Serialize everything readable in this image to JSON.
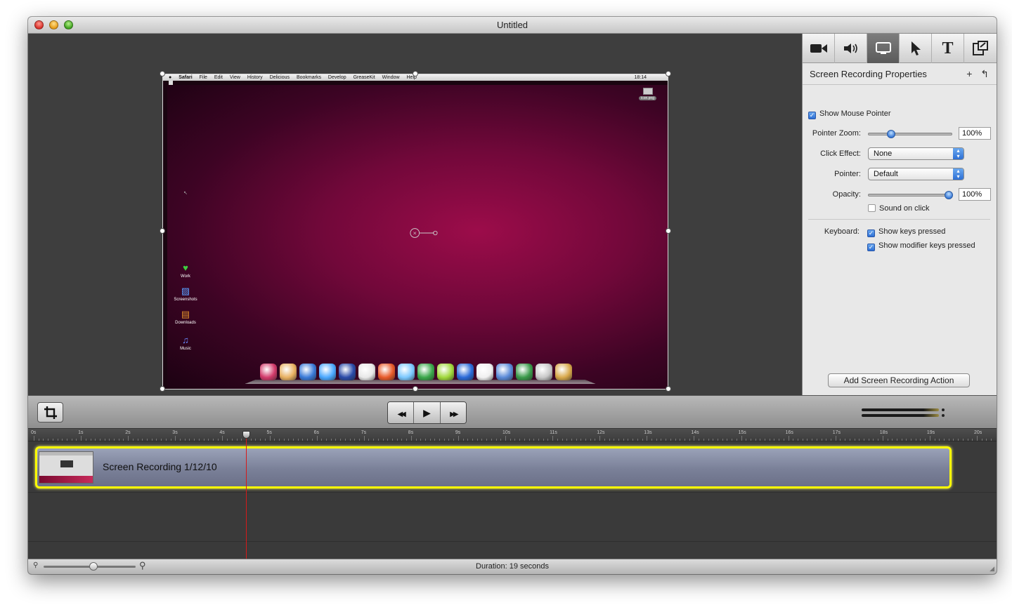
{
  "window": {
    "title": "Untitled"
  },
  "preview": {
    "menubar_items": [
      "Safari",
      "File",
      "Edit",
      "View",
      "History",
      "Delicious",
      "Bookmarks",
      "Develop",
      "GreaseKit",
      "Window",
      "Help"
    ],
    "menubar_time": "18:14",
    "desktop_icons": [
      {
        "label": "Work",
        "icon": "heart-folder-icon",
        "color": "#3fcf3f"
      },
      {
        "label": "Screenshots",
        "icon": "screenshots-folder-icon",
        "color": "#5aa0ff"
      },
      {
        "label": "Downloads",
        "icon": "downloads-folder-icon",
        "color": "#e0902a"
      },
      {
        "label": "Music",
        "icon": "music-folder-icon",
        "color": "#6a8aff"
      }
    ],
    "corner_file_label": "icon.png",
    "dock_colors": [
      "#d23a6a",
      "#e8b060",
      "#3a7ad8",
      "#4aa8ff",
      "#2a4aa8",
      "#e8e8e8",
      "#e85a2a",
      "#7ac8ff",
      "#3aa84a",
      "#a0d83a",
      "#2a6ad8",
      "#f0f0f0",
      "#5a8ad8",
      "#3a9a4a",
      "#c8c8c8",
      "#d8a84a"
    ]
  },
  "inspector": {
    "tabs": [
      {
        "name": "tab-video",
        "icon": "video-camera-icon",
        "glyph": "▰"
      },
      {
        "name": "tab-audio",
        "icon": "speaker-icon",
        "glyph": "◀"
      },
      {
        "name": "tab-screen",
        "icon": "screen-icon",
        "glyph": "▭"
      },
      {
        "name": "tab-pointer",
        "icon": "pointer-icon",
        "glyph": "➤"
      },
      {
        "name": "tab-text",
        "icon": "text-icon",
        "glyph": "T"
      },
      {
        "name": "tab-export",
        "icon": "export-icon",
        "glyph": "⧉"
      }
    ],
    "section_title": "Screen Recording Properties",
    "add_glyph": "+",
    "revert_glyph": "↰",
    "show_mouse_pointer": "Show Mouse Pointer",
    "pointer_zoom_label": "Pointer Zoom:",
    "pointer_zoom_value": "100%",
    "pointer_zoom_level": 0.24,
    "click_effect_label": "Click Effect:",
    "click_effect_value": "None",
    "pointer_label": "Pointer:",
    "pointer_value": "Default",
    "opacity_label": "Opacity:",
    "opacity_value": "100%",
    "opacity_level": 1.0,
    "sound_on_click": "Sound on click",
    "keyboard_label": "Keyboard:",
    "show_keys_pressed": "Show keys pressed",
    "show_modifier_keys": "Show modifier keys pressed",
    "add_action_button": "Add Screen Recording Action"
  },
  "controls": {
    "crop_glyph": "⌗",
    "rewind_glyph": "◀◀",
    "play_glyph": "▶",
    "forward_glyph": "▶▶"
  },
  "timeline": {
    "ticks": [
      "0s",
      "1s",
      "2s",
      "3s",
      "4s",
      "5s",
      "6s",
      "7s",
      "8s",
      "9s",
      "10s",
      "11s",
      "12s",
      "13s",
      "14s",
      "15s",
      "16s",
      "17s",
      "18s",
      "19s",
      "20s"
    ],
    "clip_label": "Screen Recording 1/12/10",
    "playhead_seconds": 4.5
  },
  "status": {
    "duration": "Duration: 19 seconds",
    "zoom_level": 0.55
  }
}
